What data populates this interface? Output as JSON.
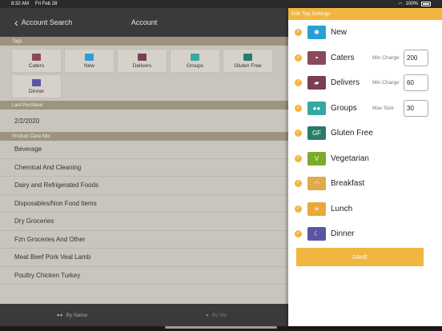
{
  "status": {
    "time": "8:32 AM",
    "date": "Fri Feb 28",
    "battery": "100%"
  },
  "navbar": {
    "back_label": "Account Search",
    "title": "Account"
  },
  "sections": {
    "tags": "Tags",
    "last_purchase": "Last Purchase",
    "product_case_mix": "Product Case Mix"
  },
  "bg_tags": [
    {
      "label": "Caters",
      "color": "#8a4a5c"
    },
    {
      "label": "New",
      "color": "#2a9fd6"
    },
    {
      "label": "Delivers",
      "color": "#7a3e56"
    },
    {
      "label": "Groups",
      "color": "#35a8a0"
    },
    {
      "label": "Gluten Free",
      "color": "#2a7c6a"
    },
    {
      "label": "Dinner",
      "color": "#5a55a0"
    }
  ],
  "last_purchase_date": "2/2/2020",
  "case_mix": [
    "Beverage",
    "Chemical And Cleaning",
    "Dairy and Refrigerated Foods",
    "Disposables/Non Food Items",
    "Dry Groceries",
    "Fzn Groceries And Other",
    "Meat Beef Pork Veal Lamb",
    "Poultry Chicken Turkey"
  ],
  "bottom": {
    "by_name": "By Name",
    "by_me": "By Me"
  },
  "panel": {
    "title": "Edit Tag Settings",
    "save_label": "SAVE",
    "tags": [
      {
        "name": "New",
        "icon": "new-badge-icon",
        "color": "#2a9fd6",
        "glyph": "✺",
        "checked": true
      },
      {
        "name": "Caters",
        "icon": "cloche-icon",
        "color": "#8a4a5c",
        "glyph": "◓",
        "checked": true,
        "field_label": "Min Charge",
        "field_value": "200"
      },
      {
        "name": "Delivers",
        "icon": "truck-icon",
        "color": "#7a3e56",
        "glyph": "▰",
        "checked": true,
        "field_label": "Min Charge",
        "field_value": "60"
      },
      {
        "name": "Groups",
        "icon": "group-icon",
        "color": "#35a8a0",
        "glyph": "●●",
        "checked": true,
        "field_label": "Max Size",
        "field_value": "30"
      },
      {
        "name": "Gluten Free",
        "icon": "gluten-free-icon",
        "color": "#2a7c6a",
        "glyph": "GF",
        "checked": true
      },
      {
        "name": "Vegetarian",
        "icon": "leaf-icon",
        "color": "#7bab2a",
        "glyph": "V",
        "checked": true
      },
      {
        "name": "Breakfast",
        "icon": "sunrise-icon",
        "color": "#e1a94a",
        "glyph": "◠",
        "checked": true
      },
      {
        "name": "Lunch",
        "icon": "sun-icon",
        "color": "#e8a93a",
        "glyph": "☀",
        "checked": true
      },
      {
        "name": "Dinner",
        "icon": "moon-icon",
        "color": "#5a55a0",
        "glyph": "☾",
        "checked": true
      }
    ]
  }
}
